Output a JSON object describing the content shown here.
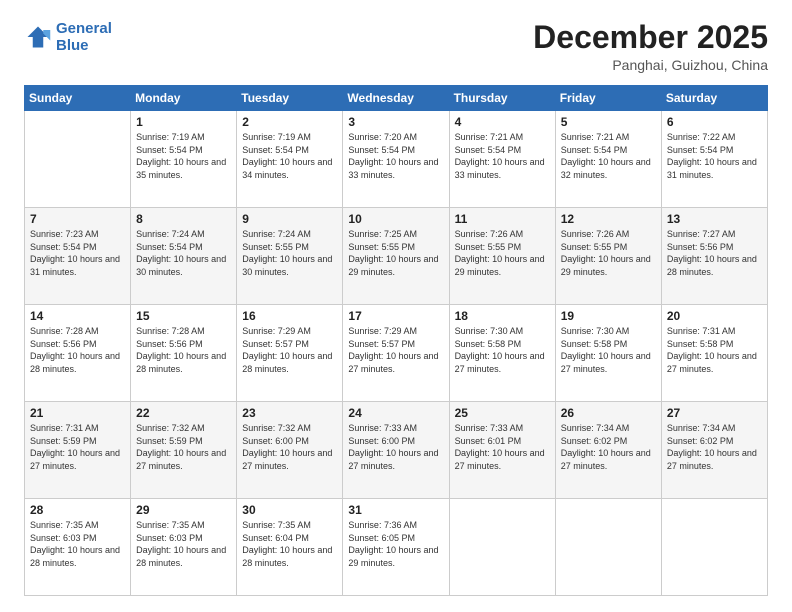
{
  "logo": {
    "line1": "General",
    "line2": "Blue"
  },
  "title": "December 2025",
  "location": "Panghai, Guizhou, China",
  "days_of_week": [
    "Sunday",
    "Monday",
    "Tuesday",
    "Wednesday",
    "Thursday",
    "Friday",
    "Saturday"
  ],
  "weeks": [
    [
      {
        "day": "",
        "sunrise": "",
        "sunset": "",
        "daylight": ""
      },
      {
        "day": "1",
        "sunrise": "Sunrise: 7:19 AM",
        "sunset": "Sunset: 5:54 PM",
        "daylight": "Daylight: 10 hours and 35 minutes."
      },
      {
        "day": "2",
        "sunrise": "Sunrise: 7:19 AM",
        "sunset": "Sunset: 5:54 PM",
        "daylight": "Daylight: 10 hours and 34 minutes."
      },
      {
        "day": "3",
        "sunrise": "Sunrise: 7:20 AM",
        "sunset": "Sunset: 5:54 PM",
        "daylight": "Daylight: 10 hours and 33 minutes."
      },
      {
        "day": "4",
        "sunrise": "Sunrise: 7:21 AM",
        "sunset": "Sunset: 5:54 PM",
        "daylight": "Daylight: 10 hours and 33 minutes."
      },
      {
        "day": "5",
        "sunrise": "Sunrise: 7:21 AM",
        "sunset": "Sunset: 5:54 PM",
        "daylight": "Daylight: 10 hours and 32 minutes."
      },
      {
        "day": "6",
        "sunrise": "Sunrise: 7:22 AM",
        "sunset": "Sunset: 5:54 PM",
        "daylight": "Daylight: 10 hours and 31 minutes."
      }
    ],
    [
      {
        "day": "7",
        "sunrise": "Sunrise: 7:23 AM",
        "sunset": "Sunset: 5:54 PM",
        "daylight": "Daylight: 10 hours and 31 minutes."
      },
      {
        "day": "8",
        "sunrise": "Sunrise: 7:24 AM",
        "sunset": "Sunset: 5:54 PM",
        "daylight": "Daylight: 10 hours and 30 minutes."
      },
      {
        "day": "9",
        "sunrise": "Sunrise: 7:24 AM",
        "sunset": "Sunset: 5:55 PM",
        "daylight": "Daylight: 10 hours and 30 minutes."
      },
      {
        "day": "10",
        "sunrise": "Sunrise: 7:25 AM",
        "sunset": "Sunset: 5:55 PM",
        "daylight": "Daylight: 10 hours and 29 minutes."
      },
      {
        "day": "11",
        "sunrise": "Sunrise: 7:26 AM",
        "sunset": "Sunset: 5:55 PM",
        "daylight": "Daylight: 10 hours and 29 minutes."
      },
      {
        "day": "12",
        "sunrise": "Sunrise: 7:26 AM",
        "sunset": "Sunset: 5:55 PM",
        "daylight": "Daylight: 10 hours and 29 minutes."
      },
      {
        "day": "13",
        "sunrise": "Sunrise: 7:27 AM",
        "sunset": "Sunset: 5:56 PM",
        "daylight": "Daylight: 10 hours and 28 minutes."
      }
    ],
    [
      {
        "day": "14",
        "sunrise": "Sunrise: 7:28 AM",
        "sunset": "Sunset: 5:56 PM",
        "daylight": "Daylight: 10 hours and 28 minutes."
      },
      {
        "day": "15",
        "sunrise": "Sunrise: 7:28 AM",
        "sunset": "Sunset: 5:56 PM",
        "daylight": "Daylight: 10 hours and 28 minutes."
      },
      {
        "day": "16",
        "sunrise": "Sunrise: 7:29 AM",
        "sunset": "Sunset: 5:57 PM",
        "daylight": "Daylight: 10 hours and 28 minutes."
      },
      {
        "day": "17",
        "sunrise": "Sunrise: 7:29 AM",
        "sunset": "Sunset: 5:57 PM",
        "daylight": "Daylight: 10 hours and 27 minutes."
      },
      {
        "day": "18",
        "sunrise": "Sunrise: 7:30 AM",
        "sunset": "Sunset: 5:58 PM",
        "daylight": "Daylight: 10 hours and 27 minutes."
      },
      {
        "day": "19",
        "sunrise": "Sunrise: 7:30 AM",
        "sunset": "Sunset: 5:58 PM",
        "daylight": "Daylight: 10 hours and 27 minutes."
      },
      {
        "day": "20",
        "sunrise": "Sunrise: 7:31 AM",
        "sunset": "Sunset: 5:58 PM",
        "daylight": "Daylight: 10 hours and 27 minutes."
      }
    ],
    [
      {
        "day": "21",
        "sunrise": "Sunrise: 7:31 AM",
        "sunset": "Sunset: 5:59 PM",
        "daylight": "Daylight: 10 hours and 27 minutes."
      },
      {
        "day": "22",
        "sunrise": "Sunrise: 7:32 AM",
        "sunset": "Sunset: 5:59 PM",
        "daylight": "Daylight: 10 hours and 27 minutes."
      },
      {
        "day": "23",
        "sunrise": "Sunrise: 7:32 AM",
        "sunset": "Sunset: 6:00 PM",
        "daylight": "Daylight: 10 hours and 27 minutes."
      },
      {
        "day": "24",
        "sunrise": "Sunrise: 7:33 AM",
        "sunset": "Sunset: 6:00 PM",
        "daylight": "Daylight: 10 hours and 27 minutes."
      },
      {
        "day": "25",
        "sunrise": "Sunrise: 7:33 AM",
        "sunset": "Sunset: 6:01 PM",
        "daylight": "Daylight: 10 hours and 27 minutes."
      },
      {
        "day": "26",
        "sunrise": "Sunrise: 7:34 AM",
        "sunset": "Sunset: 6:02 PM",
        "daylight": "Daylight: 10 hours and 27 minutes."
      },
      {
        "day": "27",
        "sunrise": "Sunrise: 7:34 AM",
        "sunset": "Sunset: 6:02 PM",
        "daylight": "Daylight: 10 hours and 27 minutes."
      }
    ],
    [
      {
        "day": "28",
        "sunrise": "Sunrise: 7:35 AM",
        "sunset": "Sunset: 6:03 PM",
        "daylight": "Daylight: 10 hours and 28 minutes."
      },
      {
        "day": "29",
        "sunrise": "Sunrise: 7:35 AM",
        "sunset": "Sunset: 6:03 PM",
        "daylight": "Daylight: 10 hours and 28 minutes."
      },
      {
        "day": "30",
        "sunrise": "Sunrise: 7:35 AM",
        "sunset": "Sunset: 6:04 PM",
        "daylight": "Daylight: 10 hours and 28 minutes."
      },
      {
        "day": "31",
        "sunrise": "Sunrise: 7:36 AM",
        "sunset": "Sunset: 6:05 PM",
        "daylight": "Daylight: 10 hours and 29 minutes."
      },
      {
        "day": "",
        "sunrise": "",
        "sunset": "",
        "daylight": ""
      },
      {
        "day": "",
        "sunrise": "",
        "sunset": "",
        "daylight": ""
      },
      {
        "day": "",
        "sunrise": "",
        "sunset": "",
        "daylight": ""
      }
    ]
  ]
}
